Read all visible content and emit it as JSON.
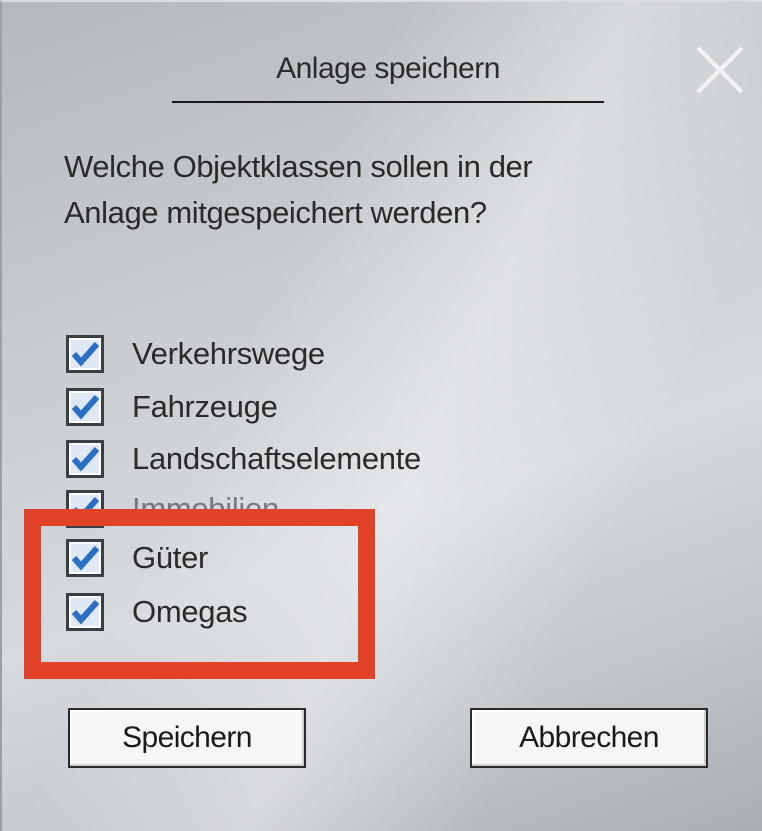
{
  "dialog": {
    "title": "Anlage speichern",
    "close_icon": "close-icon",
    "question_line1": "Welche Objektklassen sollen in der",
    "question_line2": "Anlage mitgespeichert werden?"
  },
  "checkboxes": [
    {
      "label": "Verkehrswege",
      "checked": true
    },
    {
      "label": "Fahrzeuge",
      "checked": true
    },
    {
      "label": "Landschaftselemente",
      "checked": true
    },
    {
      "label": "Immobilien",
      "checked": true
    },
    {
      "label": "Güter",
      "checked": true
    },
    {
      "label": "Omegas",
      "checked": true
    }
  ],
  "buttons": {
    "save_label": "Speichern",
    "cancel_label": "Abbrechen"
  },
  "colors": {
    "highlight": "#e24227",
    "check": "#2a6fc4"
  }
}
